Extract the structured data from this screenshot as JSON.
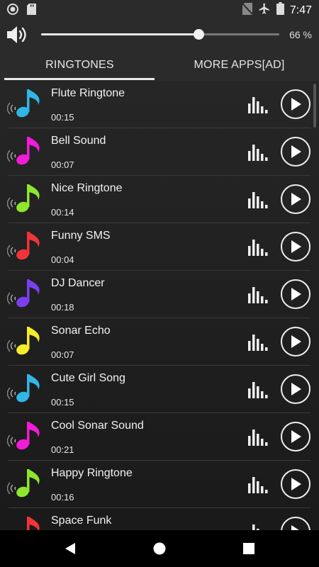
{
  "status_bar": {
    "time": "7:47"
  },
  "volume": {
    "percent_label": "66 %",
    "level": 0.66
  },
  "tabs": [
    {
      "label": "RINGTONES",
      "active": true
    },
    {
      "label": "MORE APPS[AD]",
      "active": false
    }
  ],
  "ringtones": [
    {
      "title": "Flute Ringtone",
      "duration": "00:15",
      "color": "#31b6e7"
    },
    {
      "title": "Bell Sound",
      "duration": "00:07",
      "color": "#f11bd8"
    },
    {
      "title": "Nice Ringtone",
      "duration": "00:14",
      "color": "#8ee62d"
    },
    {
      "title": "Funny SMS",
      "duration": "00:04",
      "color": "#f0343a"
    },
    {
      "title": "DJ Dancer",
      "duration": "00:18",
      "color": "#7b3ff0"
    },
    {
      "title": "Sonar Echo",
      "duration": "00:07",
      "color": "#f5ec2a"
    },
    {
      "title": "Cute Girl Song",
      "duration": "00:15",
      "color": "#31b6e7"
    },
    {
      "title": "Cool Sonar Sound",
      "duration": "00:21",
      "color": "#f11bd8"
    },
    {
      "title": "Happy Ringtone",
      "duration": "00:16",
      "color": "#8ee62d"
    },
    {
      "title": "Space Funk",
      "duration": "",
      "color": "#f0343a"
    }
  ],
  "icons": {
    "status_left": [
      "record-icon",
      "sd-card-icon"
    ],
    "status_right": [
      "no-sim-icon",
      "airplane-icon",
      "battery-icon"
    ],
    "nav": [
      "back-icon",
      "home-icon",
      "recents-icon"
    ]
  }
}
